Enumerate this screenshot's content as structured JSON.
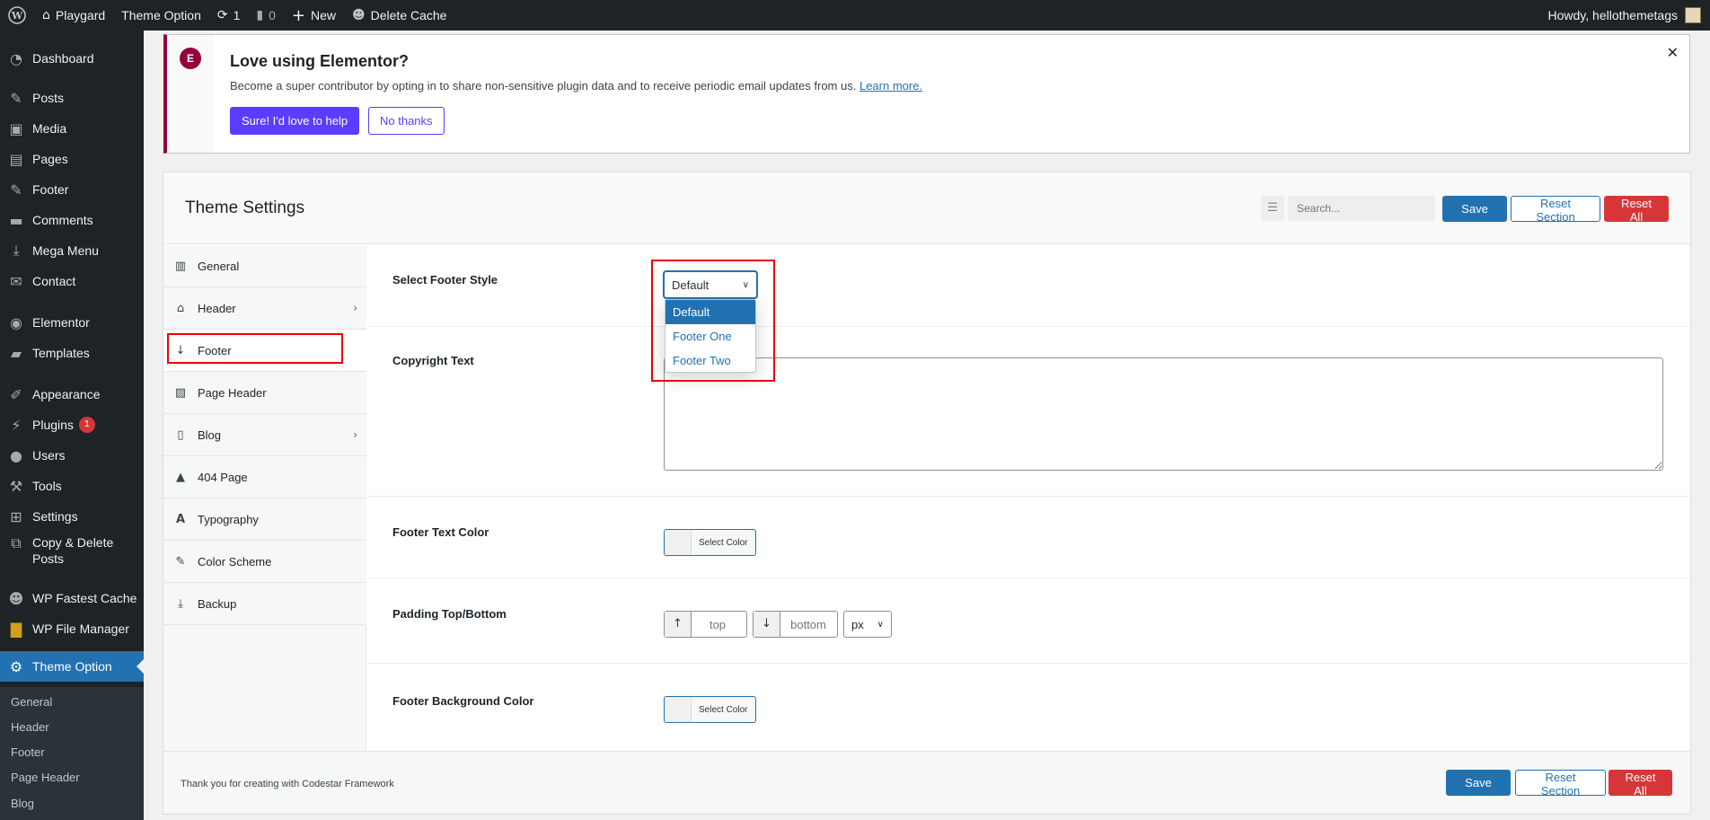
{
  "adminbar": {
    "site_name": "Playgard",
    "theme_option": "Theme Option",
    "updates_count": "1",
    "comments_count": "0",
    "new_label": "New",
    "delete_cache": "Delete Cache",
    "howdy": "Howdy, hellothemetags"
  },
  "sidebar": {
    "items": [
      {
        "label": "Dashboard",
        "icon": "dashboard-icon"
      },
      {
        "label": "Posts",
        "icon": "pin-icon"
      },
      {
        "label": "Media",
        "icon": "media-icon"
      },
      {
        "label": "Pages",
        "icon": "pages-icon"
      },
      {
        "label": "Footer",
        "icon": "pin-icon"
      },
      {
        "label": "Comments",
        "icon": "comment-icon"
      },
      {
        "label": "Mega Menu",
        "icon": "download-icon"
      },
      {
        "label": "Contact",
        "icon": "mail-icon"
      },
      {
        "label": "Elementor",
        "icon": "elementor-icon"
      },
      {
        "label": "Templates",
        "icon": "folder-icon"
      },
      {
        "label": "Appearance",
        "icon": "brush-icon"
      },
      {
        "label": "Plugins",
        "icon": "plugin-icon",
        "badge": "1"
      },
      {
        "label": "Users",
        "icon": "user-icon"
      },
      {
        "label": "Tools",
        "icon": "wrench-icon"
      },
      {
        "label": "Settings",
        "icon": "settings-icon"
      },
      {
        "label": "Copy & Delete",
        "label2": "Posts",
        "icon": "copy-icon"
      },
      {
        "label": "WP Fastest Cache",
        "icon": "cheetah-icon"
      },
      {
        "label": "WP File Manager",
        "icon": "file-manager-icon"
      },
      {
        "label": "Theme Option",
        "icon": "gear-icon"
      }
    ],
    "submenu": [
      "General",
      "Header",
      "Footer",
      "Page Header",
      "Blog"
    ]
  },
  "notice": {
    "title": "Love using Elementor?",
    "text": "Become a super contributor by opting in to share non-sensitive plugin data and to receive periodic email updates from us.",
    "link": "Learn more.",
    "primary_btn": "Sure! I'd love to help",
    "secondary_btn": "No thanks"
  },
  "panel": {
    "title": "Theme Settings",
    "search_placeholder": "Search...",
    "save": "Save",
    "reset_section": "Reset Section",
    "reset_all": "Reset All",
    "footer_credit": "Thank you for creating with Codestar Framework"
  },
  "secnav": {
    "items": [
      {
        "label": "General",
        "icon": "building-icon"
      },
      {
        "label": "Header",
        "icon": "home-icon",
        "arrow": true
      },
      {
        "label": "Footer",
        "icon": "arrow-down-icon",
        "active": true
      },
      {
        "label": "Page Header",
        "icon": "image-icon"
      },
      {
        "label": "Blog",
        "icon": "file-icon",
        "arrow": true
      },
      {
        "label": "404 Page",
        "icon": "warning-icon"
      },
      {
        "label": "Typography",
        "icon": "font-icon"
      },
      {
        "label": "Color Scheme",
        "icon": "paintbrush-icon"
      },
      {
        "label": "Backup",
        "icon": "download-icon"
      }
    ]
  },
  "fields": {
    "footer_style": {
      "label": "Select Footer Style",
      "value": "Default",
      "options": [
        "Default",
        "Footer One",
        "Footer Two"
      ]
    },
    "copyright": {
      "label": "Copyright Text",
      "value": ""
    },
    "text_color": {
      "label": "Footer Text Color",
      "button": "Select Color"
    },
    "padding": {
      "label": "Padding Top/Bottom",
      "top_placeholder": "top",
      "bottom_placeholder": "bottom",
      "unit": "px"
    },
    "bg_color": {
      "label": "Footer Background Color",
      "button": "Select Color"
    }
  },
  "colors": {
    "accent": "#2271b1",
    "danger": "#d63638",
    "elementor": "#5c3cff",
    "sidebar_bg": "#1d2327"
  }
}
